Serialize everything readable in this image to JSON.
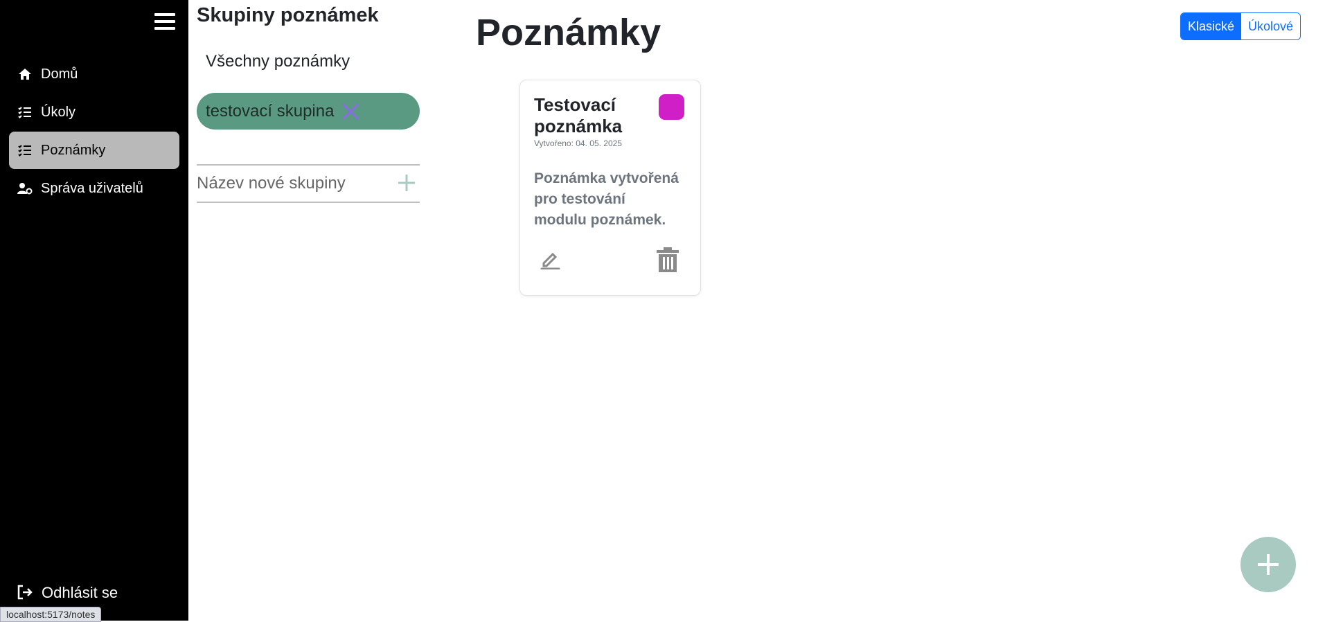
{
  "sidebar": {
    "items": [
      {
        "label": "Domů",
        "icon": "home-icon"
      },
      {
        "label": "Úkoly",
        "icon": "list-check-icon"
      },
      {
        "label": "Poznámky",
        "icon": "list-check-icon",
        "active": true
      },
      {
        "label": "Správa uživatelů",
        "icon": "user-settings-icon"
      }
    ],
    "logout_label": "Odhlásit se"
  },
  "status_bar": {
    "url": "localhost:5173/notes"
  },
  "groups": {
    "title": "Skupiny poznámek",
    "all_label": "Všechny poznámky",
    "items": [
      {
        "label": "testovací skupina",
        "color": "#5a9a83"
      }
    ],
    "new_group_placeholder": "Název nové skupiny"
  },
  "main": {
    "title": "Poznámky",
    "view_toggle": {
      "classic": "Klasické",
      "task": "Úkolové",
      "selected": "Klasické"
    },
    "notes": [
      {
        "title": "Testovací poznámka",
        "created": "Vytvořeno: 04. 05. 2025",
        "body": "Poznámka vytvořená pro testování modulu poznámek.",
        "color": "#d01fc7"
      }
    ]
  },
  "colors": {
    "accent": "#0d6efd",
    "group_pill": "#5a9a83",
    "fab": "#a8cac1",
    "sidebar_bg": "#000000"
  }
}
